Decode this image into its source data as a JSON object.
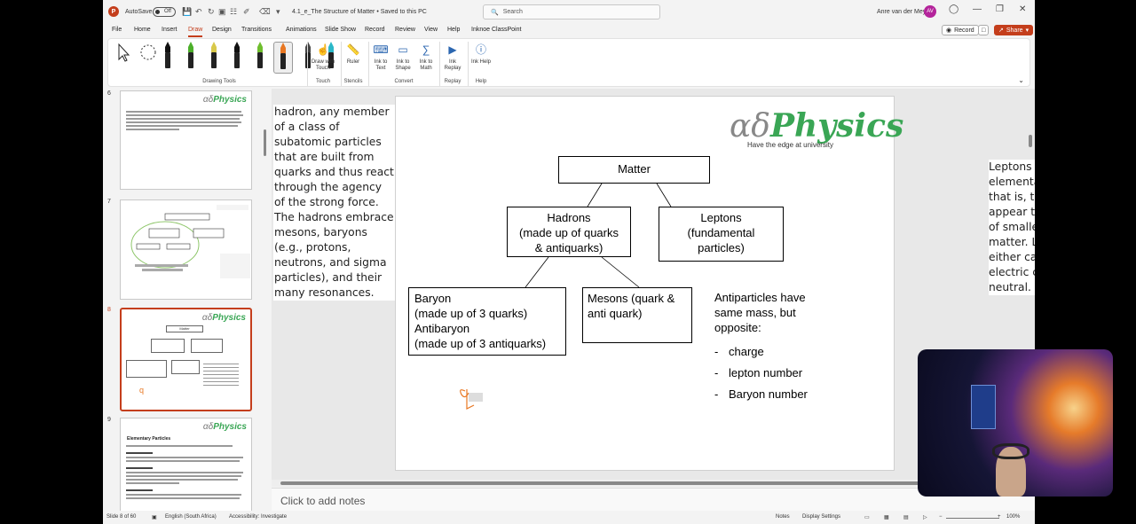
{
  "titlebar": {
    "autosave_label": "AutoSave",
    "autosave_state": "Off",
    "doc_title": "4.1_e_The Structure of Matter • Saved to this PC",
    "search_placeholder": "Search",
    "user_name": "Anre van der Mey",
    "user_initials": "AV"
  },
  "menu": {
    "items": [
      "File",
      "Home",
      "Insert",
      "Draw",
      "Design",
      "Transitions",
      "Animations",
      "Slide Show",
      "Record",
      "Review",
      "View",
      "Help",
      "Inknoe ClassPoint"
    ],
    "active": "Draw",
    "record_label": "Record",
    "share_label": "Share"
  },
  "ribbon": {
    "drawing_tools_label": "Drawing Tools",
    "draw_with_touch": "Draw with Touch",
    "ruler": "Ruler",
    "ink_to_text": "Ink to Text",
    "ink_to_shape": "Ink to Shape",
    "ink_to_math": "Ink to Math",
    "ink_replay": "Ink Replay",
    "ink_help": "Ink Help",
    "groups": {
      "touch": "Touch",
      "stencils": "Stencils",
      "convert": "Convert",
      "replay": "Replay",
      "help": "Help"
    },
    "pen_colors": [
      "#111111",
      "#4caf2a",
      "#d8c84a",
      "#111111",
      "#6fbe2e",
      "#e87722",
      "#444444",
      "#2bb8c8"
    ]
  },
  "thumbnails": {
    "slide_numbers": [
      "6",
      "7",
      "8",
      "9"
    ],
    "selected": "8",
    "thumb8_matter": "Matter",
    "thumb9_title": "Elementary Particles"
  },
  "slide": {
    "overlay_left": "hadron, any member of a class of subatomic particles that are built from quarks and thus react through the agency of the strong force. The hadrons embrace mesons, baryons (e.g., protons, neutrons, and sigma particles), and their many resonances.",
    "overlay_right": "Leptons are said to be elementary particles; that is, they do not appear to be made up of smaller units of matter. Leptons can either carry one unit of electric charge or be neutral.",
    "brand_a": "αδ",
    "brand_b": "Physics",
    "brand_tagline": "Have the edge at university",
    "matter": "Matter",
    "hadrons": "Hadrons\n(made up of quarks\n& antiquarks)",
    "leptons": "Leptons\n(fundamental\nparticles)",
    "baryon": "Baryon\n(made up of 3 quarks)\nAntibaryon\n(made up of 3 antiquarks)",
    "mesons": "Mesons (quark &\nanti quark)",
    "antiparticles_intro": "Antiparticles have\nsame mass, but\nopposite:",
    "antiparticle_props": [
      "charge",
      "lepton number",
      "Baryon number"
    ],
    "ink_color": "#e87722"
  },
  "notes": {
    "placeholder": "Click to add notes"
  },
  "status": {
    "slide_info": "Slide 8 of 60",
    "language": "English (South Africa)",
    "accessibility": "Accessibility: Investigate",
    "notes": "Notes",
    "display_settings": "Display Settings",
    "zoom": "100%"
  }
}
